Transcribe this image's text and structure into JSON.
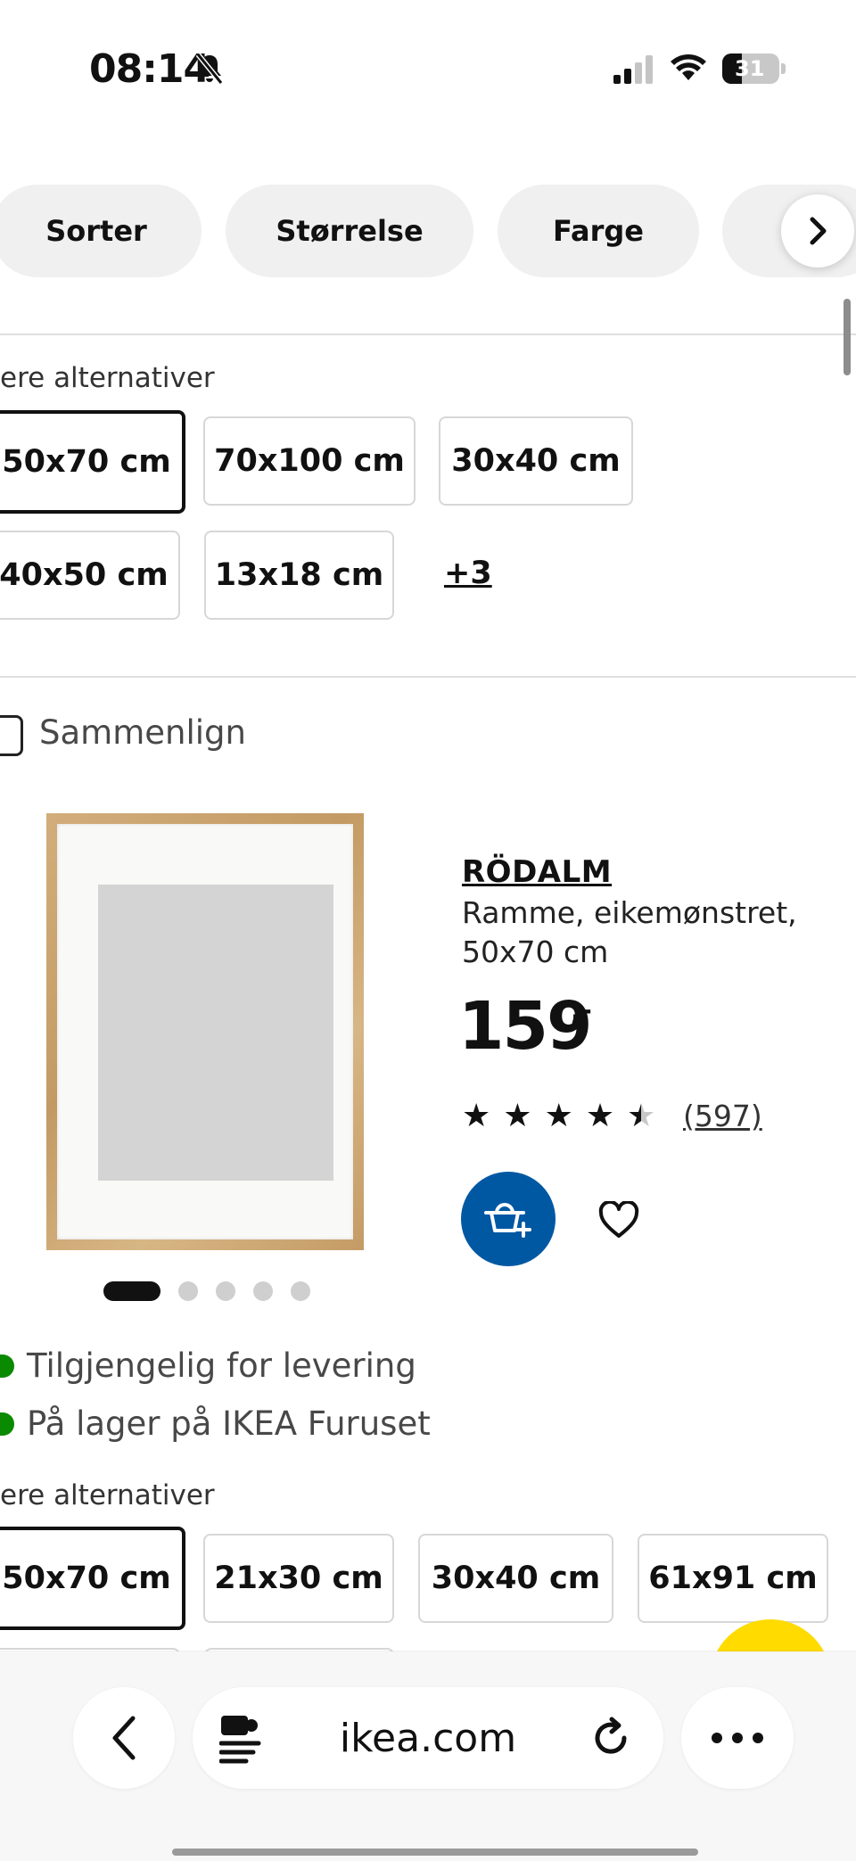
{
  "status_bar": {
    "time": "08:14",
    "battery": "31",
    "icons": [
      "bell-slash-icon",
      "signal-icon",
      "wifi-icon",
      "battery-icon"
    ]
  },
  "filters": {
    "chips": [
      "Sorter",
      "Størrelse",
      "Farge"
    ],
    "next_icon": "chevron-right-icon"
  },
  "product_top": {
    "options_label": "ere alternativer",
    "sizes_row1": [
      "50x70 cm",
      "70x100 cm",
      "30x40 cm"
    ],
    "sizes_row2": [
      "40x50 cm",
      "13x18 cm"
    ],
    "more": "+3"
  },
  "product": {
    "compare_label": "Sammenlign",
    "name": "RÖDALM",
    "description": "Ramme, eikemønstret, 50x70 cm",
    "price": "159",
    "price_suffix": ",-",
    "rating": 4.5,
    "reviews": "(597)",
    "image_slides": 5,
    "active_slide": 1,
    "availability": [
      "Tilgjengelig for levering",
      "På lager på IKEA Furuset"
    ],
    "options_label": "ere alternativer",
    "sizes": [
      "50x70 cm",
      "21x30 cm",
      "30x40 cm",
      "61x91 cm"
    ],
    "colors": {
      "brand_blue": "#0058a3",
      "stock_green": "#0a8a00",
      "ikea_yellow": "#ffdb00"
    }
  },
  "browser": {
    "url": "ikea.com"
  }
}
